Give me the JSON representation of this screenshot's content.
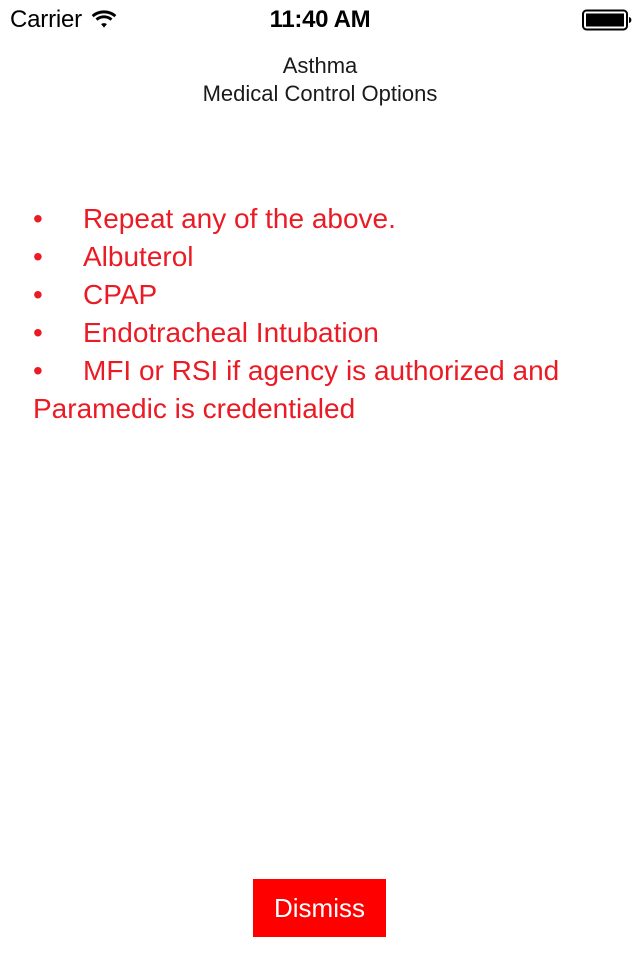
{
  "status_bar": {
    "carrier": "Carrier",
    "wifi_icon": "wifi-icon",
    "time": "11:40 AM",
    "battery_icon": "battery-full-icon"
  },
  "header": {
    "title_line1": "Asthma",
    "title_line2": "Medical Control Options"
  },
  "content": {
    "bullet_glyph": "•",
    "items": [
      "Repeat any of the above.",
      "Albuterol",
      "CPAP",
      "Endotracheal Intubation",
      "MFI or RSI if agency is authorized and Paramedic is credentialed"
    ],
    "text_color": "#ea1b24"
  },
  "footer": {
    "dismiss_label": "Dismiss",
    "dismiss_bg": "#ff0000",
    "dismiss_text_color": "#ffffff"
  }
}
